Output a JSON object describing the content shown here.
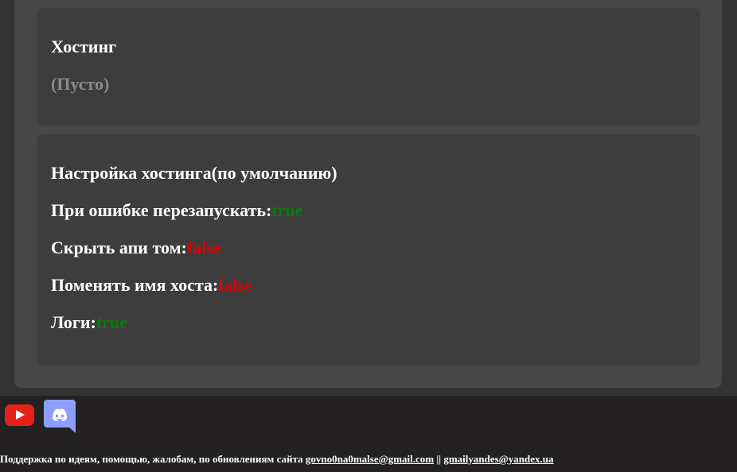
{
  "hosting": {
    "title": "Хостинг",
    "empty": "(Пусто)"
  },
  "settings": {
    "title": "Настройка хостинга(по умолчанию)",
    "items": [
      {
        "label": "При ошибке перезапускать:",
        "value": "true"
      },
      {
        "label": "Скрыть апи том:",
        "value": "false"
      },
      {
        "label": "Поменять имя хоста:",
        "value": "false"
      },
      {
        "label": "Логи:",
        "value": "true"
      }
    ]
  },
  "footer": {
    "icons": [
      "youtube-icon",
      "discord-icon"
    ],
    "support_text": "Поддержка по идеям, помощью, жалобам, по обновлениям сайта",
    "email1": "govno0na0malse@gmail.com",
    "separator": "||",
    "email2": "gmailyandes@yandex.ua"
  },
  "colors": {
    "true": "#0b7a0b",
    "false": "#e00000",
    "background": "#333333",
    "card": "#3d3d3d"
  }
}
